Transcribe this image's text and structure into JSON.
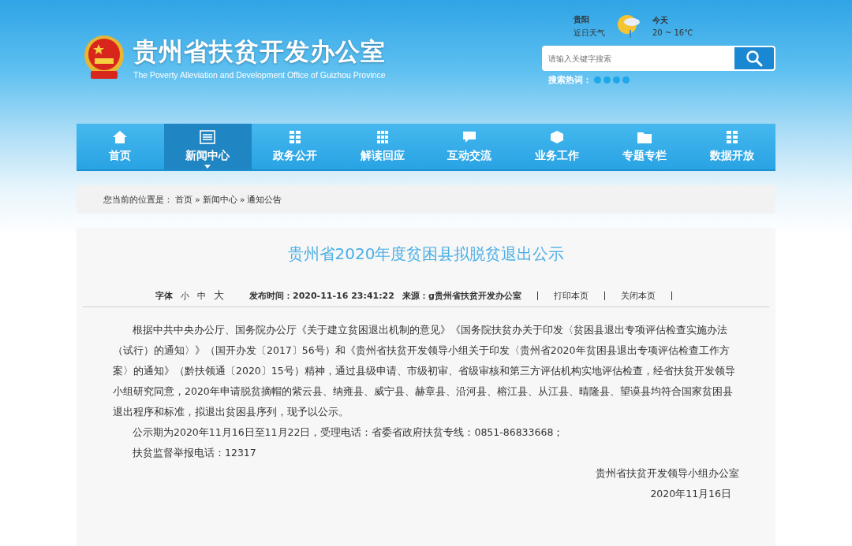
{
  "header": {
    "title": "贵州省扶贫开发办公室",
    "subtitle": "The Poverty Alleviation and Development Office of Guizhou Province"
  },
  "weather": {
    "city": "贵阳",
    "label": "近日天气",
    "day": "今天",
    "temperature": "20 ~ 16℃"
  },
  "search": {
    "placeholder": "请输入关键字搜索",
    "hot_words_label": "搜索热词："
  },
  "nav": [
    {
      "label": "首页",
      "selected": false
    },
    {
      "label": "新闻中心",
      "selected": true
    },
    {
      "label": "政务公开",
      "selected": false
    },
    {
      "label": "解读回应",
      "selected": false
    },
    {
      "label": "互动交流",
      "selected": false
    },
    {
      "label": "业务工作",
      "selected": false
    },
    {
      "label": "专题专栏",
      "selected": false
    },
    {
      "label": "数据开放",
      "selected": false
    }
  ],
  "breadcrumb": {
    "prefix": "您当前的位置是：",
    "separator": "»",
    "items": [
      "首页",
      "新闻中心",
      "通知公告"
    ]
  },
  "article": {
    "title": "贵州省2020年度贫困县拟脱贫退出公示",
    "font_label": "字体",
    "font_sizes": [
      "小",
      "中",
      "大"
    ],
    "published": "发布时间：2020-11-16 23:41:22",
    "source": "来源：g贵州省扶贫开发办公室",
    "actions": [
      "打印本页",
      "关闭本页"
    ],
    "paragraphs": [
      "根据中共中央办公厅、国务院办公厅《关于建立贫困退出机制的意见》《国务院扶贫办关于印发〈贫困县退出专项评估检查实施办法（试行）的通知〉》（国开办发〔2017〕56号）和《贵州省扶贫开发领导小组关于印发〈贵州省2020年贫困县退出专项评估检查工作方案〉的通知》（黔扶领通〔2020〕15号）精神，通过县级申请、市级初审、省级审核和第三方评估机构实地评估检查，经省扶贫开发领导小组研究同意，2020年申请脱贫摘帽的紫云县、纳雍县、威宁县、赫章县、沿河县、榕江县、从江县、晴隆县、望谟县均符合国家贫困县退出程序和标准，拟退出贫困县序列，现予以公示。",
      "公示期为2020年11月16日至11月22日，受理电话：省委省政府扶贫专线：0851-86833668；",
      "扶贫监督举报电话：12317"
    ],
    "signature": "贵州省扶贫开发领导小组办公室",
    "date": "2020年11月16日"
  }
}
